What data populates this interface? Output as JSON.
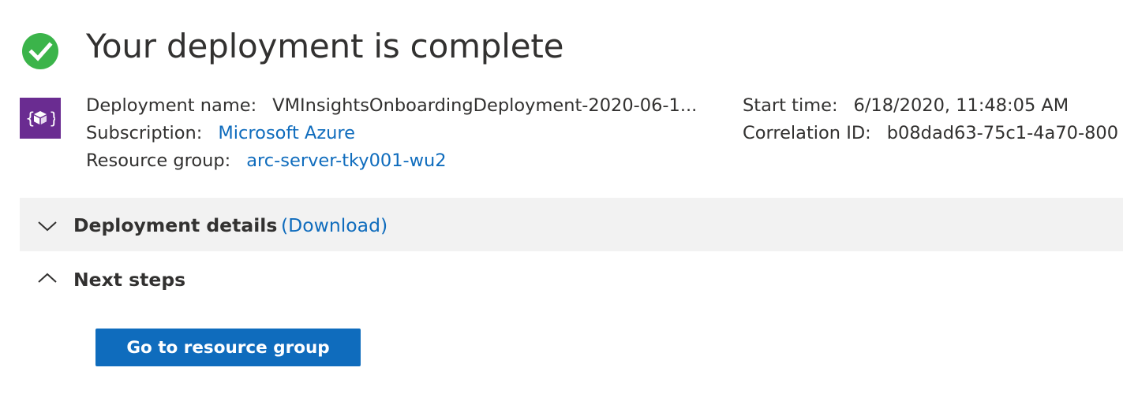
{
  "header": {
    "title": "Your deployment is complete",
    "status": "success",
    "status_color": "#3bb44a"
  },
  "resource_icon": {
    "name": "deployment-template-icon",
    "color": "#6a2c91"
  },
  "deployment_info": {
    "deployment_name_label": "Deployment name:",
    "deployment_name_value": "VMInsightsOnboardingDeployment-2020-06-1...",
    "subscription_label": "Subscription:",
    "subscription_value": "Microsoft Azure",
    "resource_group_label": "Resource group:",
    "resource_group_value": "arc-server-tky001-wu2",
    "start_time_label": "Start time:",
    "start_time_value": "6/18/2020, 11:48:05 AM",
    "correlation_id_label": "Correlation ID:",
    "correlation_id_value": "b08dad63-75c1-4a70-800"
  },
  "sections": {
    "details_title": "Deployment details",
    "details_download": "(Download)",
    "details_expanded": false,
    "next_steps_title": "Next steps",
    "next_steps_expanded": true
  },
  "actions": {
    "go_to_resource_group": "Go to resource group"
  },
  "colors": {
    "link": "#0f6cbd",
    "primary_button": "#0f6cbd",
    "section_bar": "#f2f2f2"
  }
}
